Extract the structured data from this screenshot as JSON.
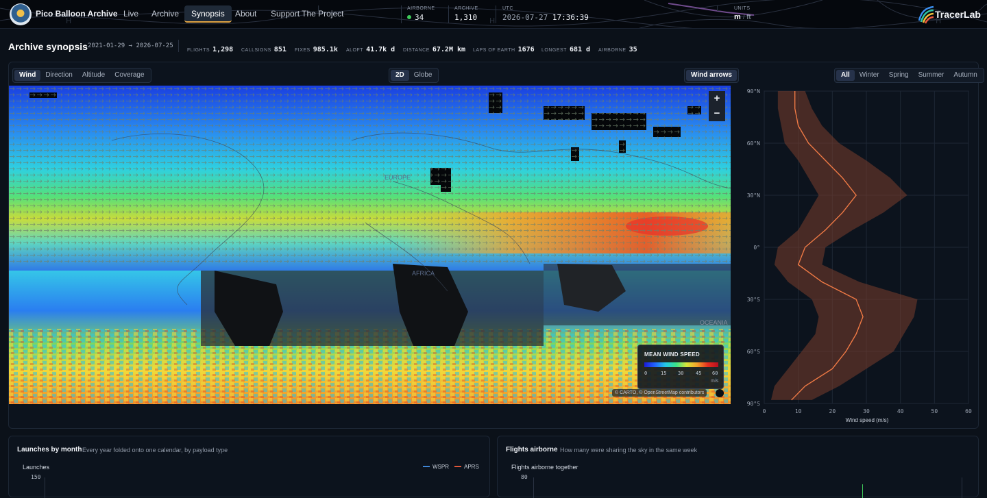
{
  "app": {
    "title": "Pico Balloon Archive",
    "nav": [
      "Live",
      "Archive",
      "Synopsis",
      "About",
      "Support The Project"
    ],
    "active_nav": "Synopsis"
  },
  "header_stats": {
    "airborne_label": "AIRBORNE",
    "airborne_value": "34",
    "archive_label": "ARCHIVE",
    "archive_value": "1,310",
    "utc_label": "UTC",
    "utc_date": "2026-07-27",
    "utc_time": "17:36:39",
    "units_label": "UNITS",
    "units_options": [
      "m",
      "ft"
    ],
    "units_selected": "m"
  },
  "tracerlab": {
    "name": "TracerLab"
  },
  "synopsis": {
    "title": "Archive synopsis",
    "range": "2021-01-29 → 2026-07-25",
    "items": [
      {
        "label": "FLIGHTS",
        "value": "1,298"
      },
      {
        "label": "CALLSIGNS",
        "value": "851"
      },
      {
        "label": "FIXES",
        "value": "985.1k"
      },
      {
        "label": "ALOFT",
        "value": "41.7k d"
      },
      {
        "label": "DISTANCE",
        "value": "67.2M km"
      },
      {
        "label": "LAPS OF EARTH",
        "value": "1676"
      },
      {
        "label": "LONGEST",
        "value": "681 d"
      },
      {
        "label": "AIRBORNE",
        "value": "35"
      }
    ]
  },
  "map_controls": {
    "layer_tabs": [
      "Wind",
      "Direction",
      "Altitude",
      "Coverage"
    ],
    "layer_selected": "Wind",
    "view_tabs": [
      "2D",
      "Globe"
    ],
    "view_selected": "2D",
    "wind_arrows_label": "Wind arrows",
    "zoom_in": "+",
    "zoom_out": "−"
  },
  "map_labels": [
    "EUROPE",
    "AFRICA",
    "OCEANIA"
  ],
  "legend": {
    "title": "MEAN WIND SPEED",
    "ticks": [
      "0",
      "15",
      "30",
      "45",
      "60"
    ],
    "unit": "m/s",
    "colors": [
      "#1b1bd8",
      "#2163ff",
      "#23c7e8",
      "#39e38b",
      "#d8e63a",
      "#f3a12a",
      "#e42d1f",
      "#b50f1f"
    ]
  },
  "attribution": "© CARTO, © OpenStreetMap contributors",
  "season_tabs": [
    "All",
    "Winter",
    "Spring",
    "Summer",
    "Autumn"
  ],
  "season_selected": "All",
  "chart_data": {
    "type": "line",
    "title": "",
    "xlabel": "Wind speed (m/s)",
    "ylabel": "",
    "xlim": [
      0,
      60
    ],
    "ylim": [
      -90,
      90
    ],
    "x_ticks": [
      "0",
      "10",
      "20",
      "30",
      "40",
      "50",
      "60"
    ],
    "y_ticks": [
      "90°N",
      "60°N",
      "30°N",
      "0°",
      "30°S",
      "60°S",
      "90°S"
    ],
    "latitudes": [
      90,
      80,
      70,
      60,
      50,
      40,
      30,
      20,
      10,
      0,
      -10,
      -20,
      -30,
      -40,
      -50,
      -60,
      -70,
      -80,
      -88
    ],
    "mean": [
      9,
      9,
      10,
      13,
      18,
      23,
      27,
      23,
      18,
      12,
      10,
      17,
      27,
      29,
      27,
      24,
      20,
      12,
      8
    ],
    "band_low": [
      4,
      4,
      5,
      6,
      10,
      13,
      16,
      13,
      10,
      4,
      3,
      7,
      14,
      16,
      15,
      11,
      7,
      3,
      2
    ],
    "band_high": [
      12,
      14,
      17,
      22,
      30,
      37,
      42,
      35,
      26,
      18,
      17,
      28,
      45,
      44,
      41,
      38,
      30,
      22,
      14
    ],
    "line_color": "#f07a45"
  },
  "launches_card": {
    "title": "Launches by month",
    "subtitle": "Every year folded onto one calendar, by payload type",
    "axis_label": "Launches",
    "first_tick": "150",
    "legend": [
      {
        "name": "WSPR",
        "color": "#3f86d6"
      },
      {
        "name": "APRS",
        "color": "#e0573a"
      }
    ]
  },
  "airborne_card": {
    "title": "Flights airborne",
    "subtitle": "How many were sharing the sky in the same week",
    "axis_label": "Flights airborne together",
    "first_tick": "80"
  }
}
